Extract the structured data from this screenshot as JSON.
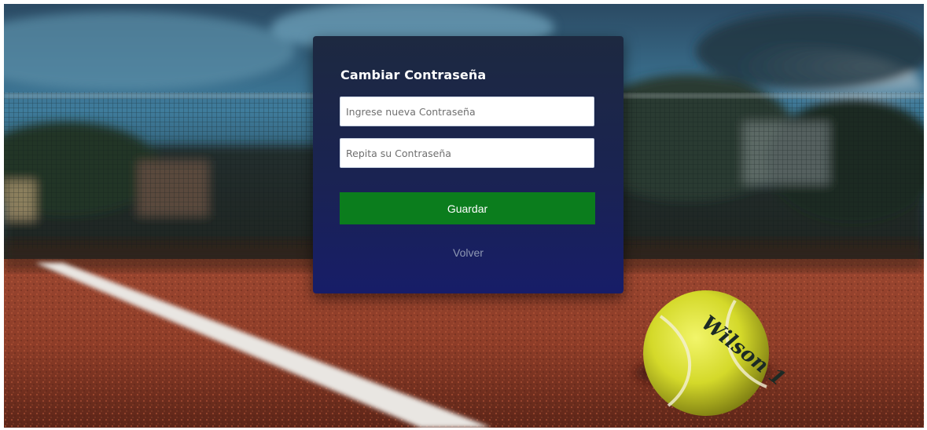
{
  "background": {
    "description_icon": "tennis-court-background-image",
    "ball_text": "Wilson 1"
  },
  "form": {
    "title": "Cambiar Contraseña",
    "new_password": {
      "value": "",
      "placeholder": "Ingrese nueva Contraseña"
    },
    "repeat_password": {
      "value": "",
      "placeholder": "Repita su Contraseña"
    },
    "save_label": "Guardar",
    "back_label": "Volver"
  },
  "colors": {
    "card_top": "#1d2940",
    "card_bottom": "#171d68",
    "save_button": "#0b7d1d",
    "back_link": "#8e98b3"
  }
}
